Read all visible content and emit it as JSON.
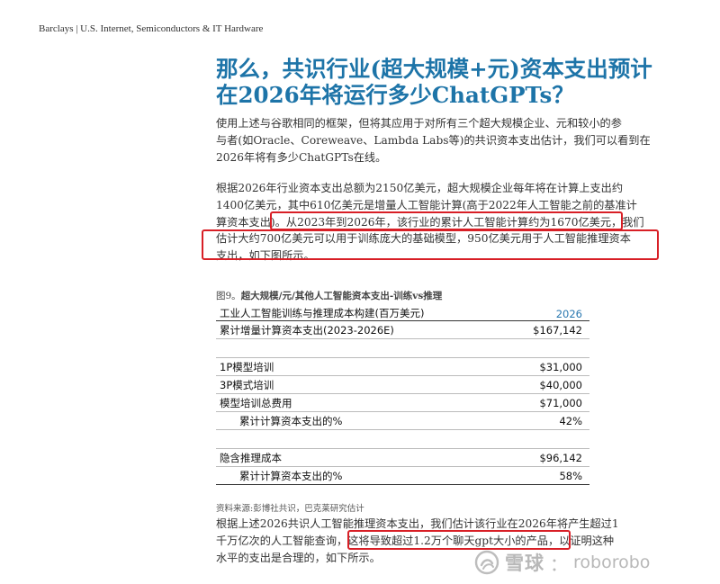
{
  "header": {
    "text": "Barclays | U.S. Internet, Semiconductors & IT Hardware"
  },
  "title": {
    "line1": "那么，共识行业(超大规模+元)资本支出预计",
    "line2": "在2026年将运行多少ChatGPTs？"
  },
  "para1": [
    "使用上述与谷歌相同的框架，但将其应用于对所有三个超大规模企业、元和较小的参",
    "与者(如Oracle、Coreweave、Lambda Labs等)的共识资本支出估计，我们可以看到在",
    "2026年将有多少ChatGPTs在线。"
  ],
  "para2": [
    "根据2026年行业资本支出总额为2150亿美元，超大规模企业每年将在计算上支出约",
    "1400亿美元，其中610亿美元是增量人工智能计算(高于2022年人工智能之前的基准计",
    "算资本支出)。从2023年到2026年，该行业的累计人工智能计算约为1670亿美元，我们",
    "估计大约700亿美元可以用于训练庞大的基础模型，950亿美元用于人工智能推理资本",
    "支出，如下图所示。"
  ],
  "figure": {
    "caption_prefix": "图9。",
    "caption_title": "超大规模/元/其他人工智能资本支出-训练vs推理",
    "table_title": "工业人工智能训练与推理成本构建(百万美元)",
    "year": "2026",
    "rows": [
      {
        "label": "累计增量计算资本支出(2023-2026E)",
        "value": "$167,142"
      },
      {
        "label": "",
        "value": ""
      },
      {
        "label": "1P模型培训",
        "value": "$31,000"
      },
      {
        "label": "3P模式培训",
        "value": "$40,000"
      },
      {
        "label": "模型培训总费用",
        "value": "$71,000"
      },
      {
        "label": "累计计算资本支出的%",
        "value": "42%"
      },
      {
        "label": "",
        "value": ""
      },
      {
        "label": "隐含推理成本",
        "value": "$96,142"
      },
      {
        "label": "累计计算资本支出的%",
        "value": "58%"
      }
    ],
    "source": "资料来源:彭博社共识，巴克莱研究估计"
  },
  "para3": [
    "根据上述2026共识人工智能推理资本支出，我们估计该行业在2026年将产生超过1",
    "千万亿次的人工智能查询，这将导致超过1.2万个聊天gpt大小的产品，以证明这种",
    "水平的支出是合理的，如下所示。"
  ],
  "watermark": {
    "brand": "雪球",
    "separator": "：",
    "user": "roborobo"
  },
  "colors": {
    "title": "#1d74a8",
    "highlight": "#d81f26",
    "year": "#2a78b0"
  }
}
